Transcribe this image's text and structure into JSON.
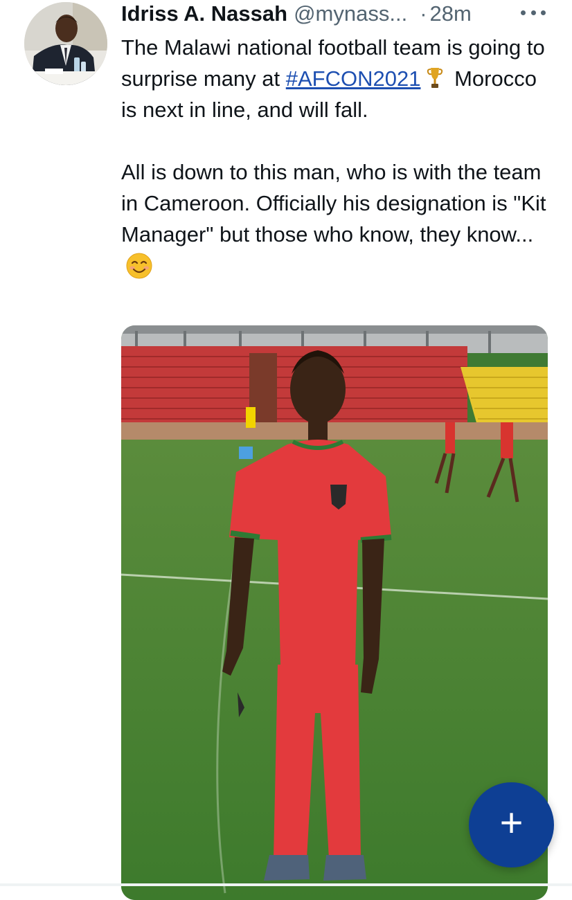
{
  "tweet": {
    "author_name": "Idriss A. Nassah",
    "author_handle": "@mynass...",
    "separator": "·",
    "timestamp": "28m",
    "more_icon": "more-horizontal-icon",
    "text_p1_a": "The Malawi national football team is going to surprise many at ",
    "hashtag": "#AFCON2021",
    "emoji_trophy": "trophy-icon",
    "text_p1_b": " Morocco is next in line, and will fall.",
    "text_p2": "All is down to this man, who is with the team in Cameroon. Officially his designation is \"Kit Manager\" but those who know, they know...",
    "emoji_smile": "smiling-face-icon"
  },
  "fab": {
    "label": "+",
    "icon": "compose-plus-icon"
  },
  "colors": {
    "accent": "#0e3f94",
    "hashtag": "#1d4fb1",
    "text": "#0f1419",
    "muted": "#536471"
  }
}
